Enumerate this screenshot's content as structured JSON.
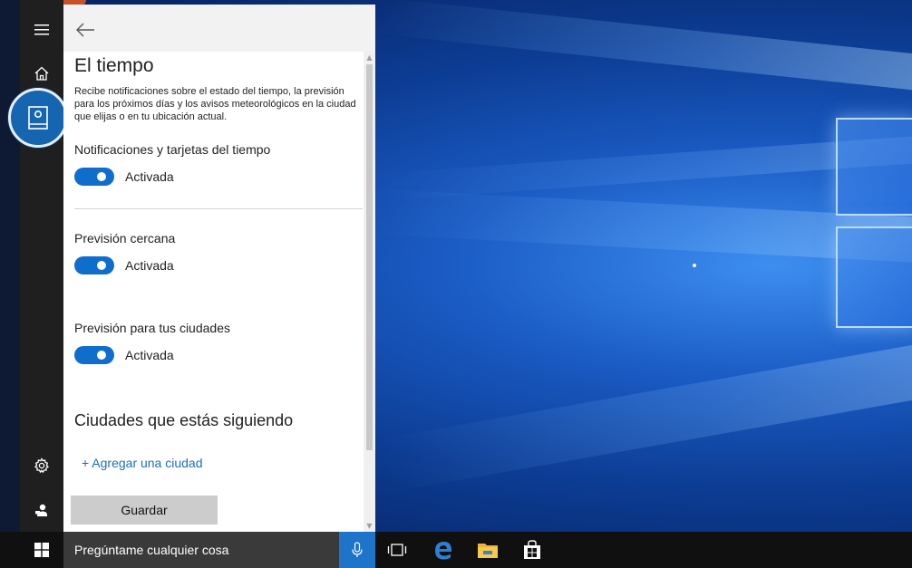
{
  "window": {
    "title": "El tiempo",
    "description": "Recibe notificaciones sobre el estado del tiempo, la previsión para los próximos días y los avisos meteorológicos en la ciudad que elijas o en tu ubicación actual."
  },
  "settings": [
    {
      "label": "Notificaciones y tarjetas del tiempo",
      "state_label": "Activada",
      "on": true
    },
    {
      "label": "Previsión cercana",
      "state_label": "Activada",
      "on": true
    },
    {
      "label": "Previsión para tus ciudades",
      "state_label": "Activada",
      "on": true
    }
  ],
  "cities": {
    "heading": "Ciudades que estás siguiendo",
    "add_label": "+ Agregar una ciudad"
  },
  "save_label": "Guardar",
  "rail": {
    "icons": [
      "hamburger-icon",
      "home-icon",
      "notebook-icon",
      "gear-icon",
      "feedback-icon"
    ]
  },
  "taskbar": {
    "search_placeholder": "Pregúntame cualquier cosa",
    "icons": [
      "windows-icon",
      "microphone-icon",
      "task-view-icon",
      "edge-icon",
      "file-explorer-icon",
      "store-icon"
    ]
  },
  "colors": {
    "accent": "#0f6dcc",
    "link": "#1a6fc2",
    "mic": "#1e74c8",
    "rail": "#1f1f1f",
    "taskbar": "#101010"
  }
}
